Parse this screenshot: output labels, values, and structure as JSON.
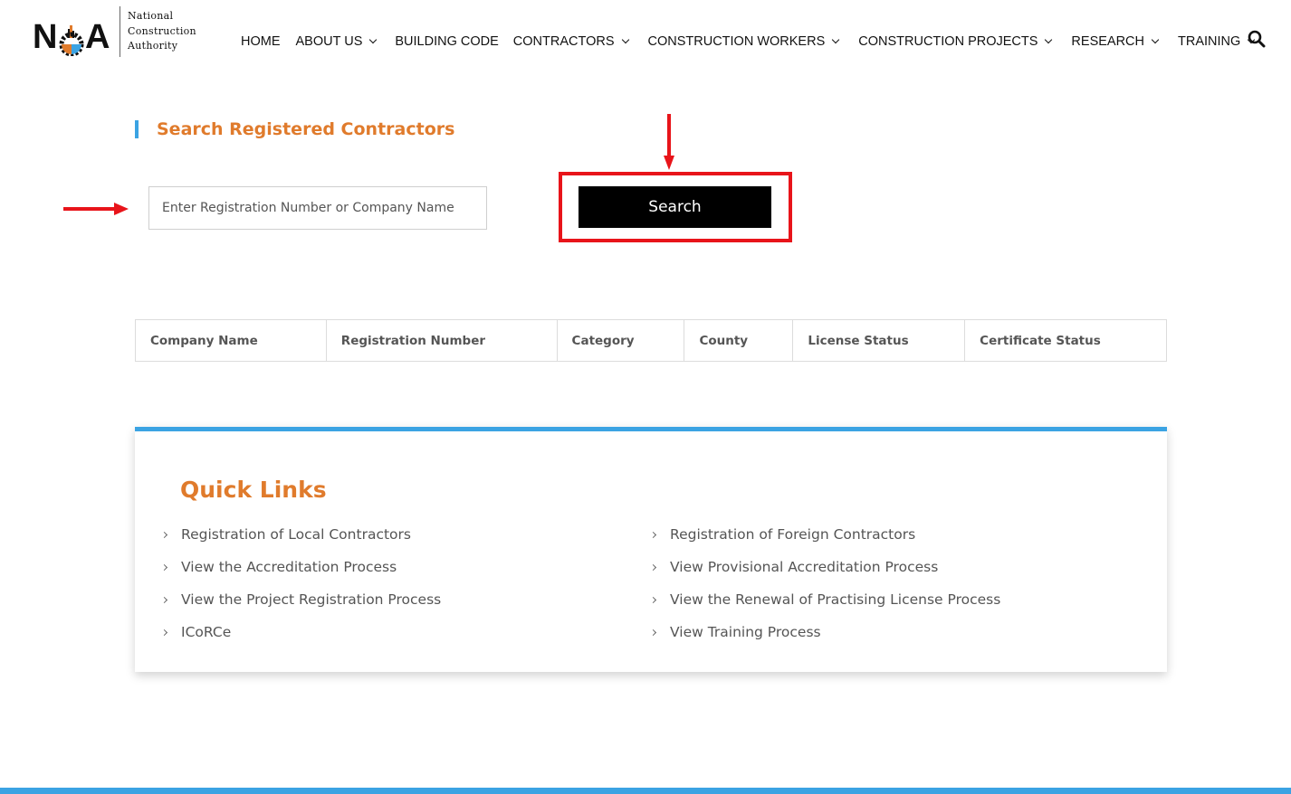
{
  "logo": {
    "letter_n": "N",
    "letter_a": "A",
    "line1": "National",
    "line2": "Construction",
    "line3": "Authority"
  },
  "nav": {
    "items": [
      {
        "label": "HOME",
        "has_dropdown": false
      },
      {
        "label": "ABOUT US",
        "has_dropdown": true
      },
      {
        "label": "BUILDING CODE",
        "has_dropdown": false
      },
      {
        "label": "CONTRACTORS",
        "has_dropdown": true
      },
      {
        "label": "CONSTRUCTION WORKERS",
        "has_dropdown": true
      },
      {
        "label": "CONSTRUCTION PROJECTS",
        "has_dropdown": true
      },
      {
        "label": "RESEARCH",
        "has_dropdown": true
      },
      {
        "label": "TRAINING",
        "has_dropdown": true
      }
    ]
  },
  "search": {
    "title": "Search Registered Contractors",
    "placeholder": "Enter Registration Number or Company Name",
    "value": "",
    "button_label": "Search"
  },
  "table": {
    "headers": [
      "Company Name",
      "Registration Number",
      "Category",
      "County",
      "License Status",
      "Certificate Status"
    ]
  },
  "quick_links": {
    "title": "Quick Links",
    "left": [
      "Registration of Local Contractors",
      "View the Accreditation Process",
      "View the Project Registration Process",
      "ICoRCe"
    ],
    "right": [
      "Registration of Foreign Contractors",
      "View Provisional Accreditation Process",
      "View the Renewal of Practising License Process",
      "View Training Process"
    ]
  },
  "colors": {
    "accent_blue": "#3ba3e3",
    "accent_orange": "#e07b2c",
    "annotation_red": "#e8141a",
    "button_black": "#000000"
  }
}
